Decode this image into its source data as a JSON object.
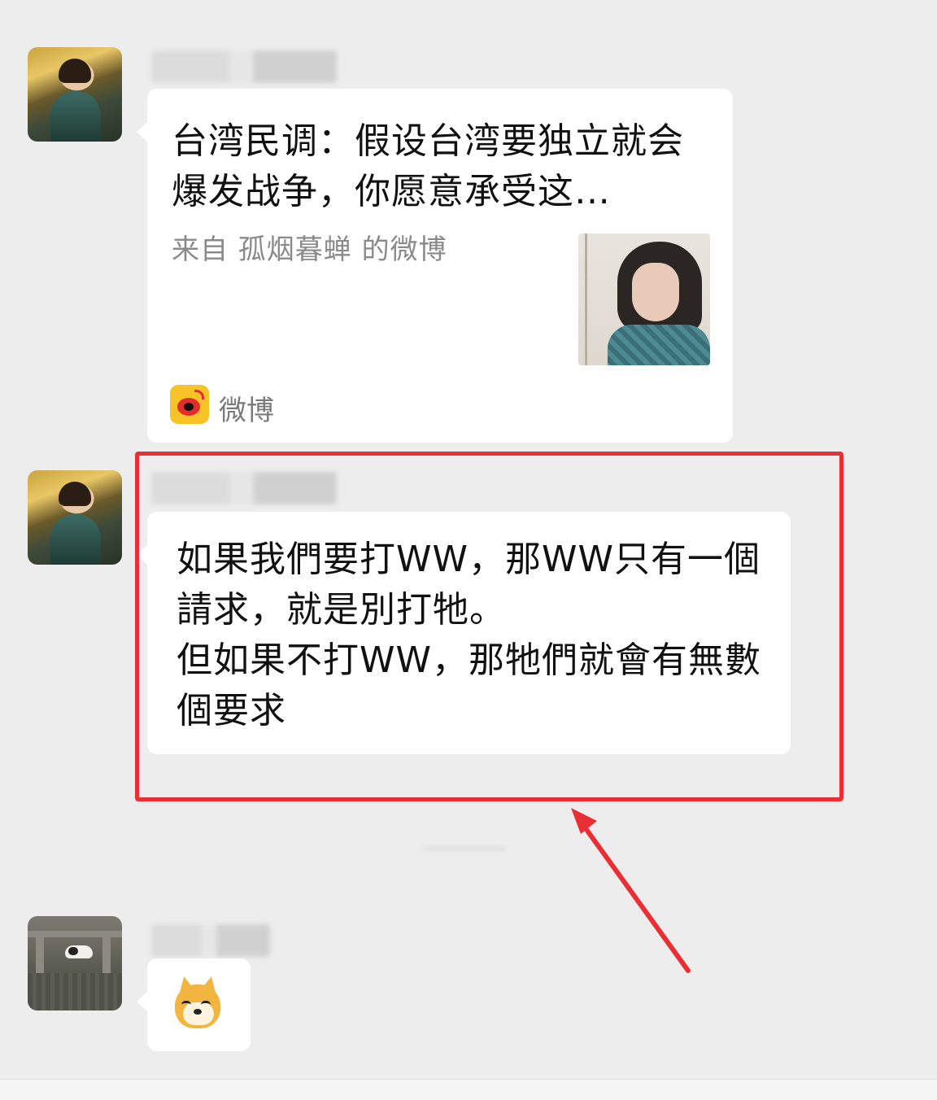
{
  "messages": [
    {
      "type": "share_card",
      "title": "台湾民调：假设台湾要独立就会爆发战争，你愿意承受这…",
      "source": "来自 孤烟暮蝉 的微博",
      "app_label": "微博",
      "app_icon": "weibo-icon"
    },
    {
      "type": "text",
      "text": "如果我們要打WW，那WW只有一個請求，就是別打牠。\n但如果不打WW，那牠們就會有無數個要求",
      "highlighted": true,
      "highlight_color": "#ea2f34"
    },
    {
      "type": "sticker",
      "sticker": "doge-emoji"
    }
  ],
  "colors": {
    "background": "#ededed",
    "bubble": "#ffffff",
    "annotation": "#ea2f34"
  }
}
